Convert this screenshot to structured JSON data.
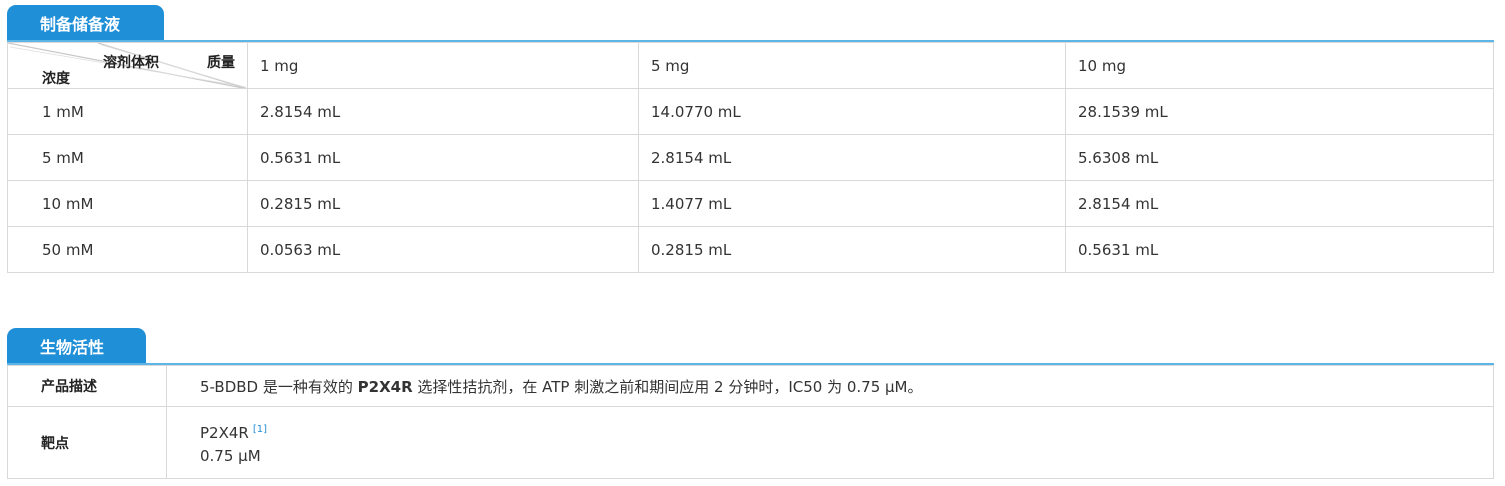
{
  "prep_section": {
    "title": "制备储备液",
    "header": {
      "mass_label": "质量",
      "volume_label": "溶剂体积",
      "concentration_label": "浓度",
      "masses": [
        "1 mg",
        "5 mg",
        "10 mg"
      ]
    },
    "rows": [
      {
        "conc": "1 mM",
        "values": [
          "2.8154 mL",
          "14.0770 mL",
          "28.1539 mL"
        ]
      },
      {
        "conc": "5 mM",
        "values": [
          "0.5631 mL",
          "2.8154 mL",
          "5.6308 mL"
        ]
      },
      {
        "conc": "10 mM",
        "values": [
          "0.2815 mL",
          "1.4077 mL",
          "2.8154 mL"
        ]
      },
      {
        "conc": "50 mM",
        "values": [
          "0.0563 mL",
          "0.2815 mL",
          "0.5631 mL"
        ]
      }
    ]
  },
  "bio_section": {
    "title": "生物活性",
    "description_label": "产品描述",
    "description_prefix": "5-BDBD 是一种有效的 ",
    "description_bold": "P2X4R",
    "description_suffix": " 选择性拮抗剂，在 ATP 刺激之前和期间应用 2 分钟时，IC50 为 0.75 μM。",
    "target_label": "靶点",
    "target_name": "P2X4R",
    "target_ref": "[1]",
    "target_value": "0.75 μM"
  },
  "colors": {
    "accent": "#1f8fd8",
    "rule": "#5bb5e6",
    "border": "#d9d9d9"
  }
}
